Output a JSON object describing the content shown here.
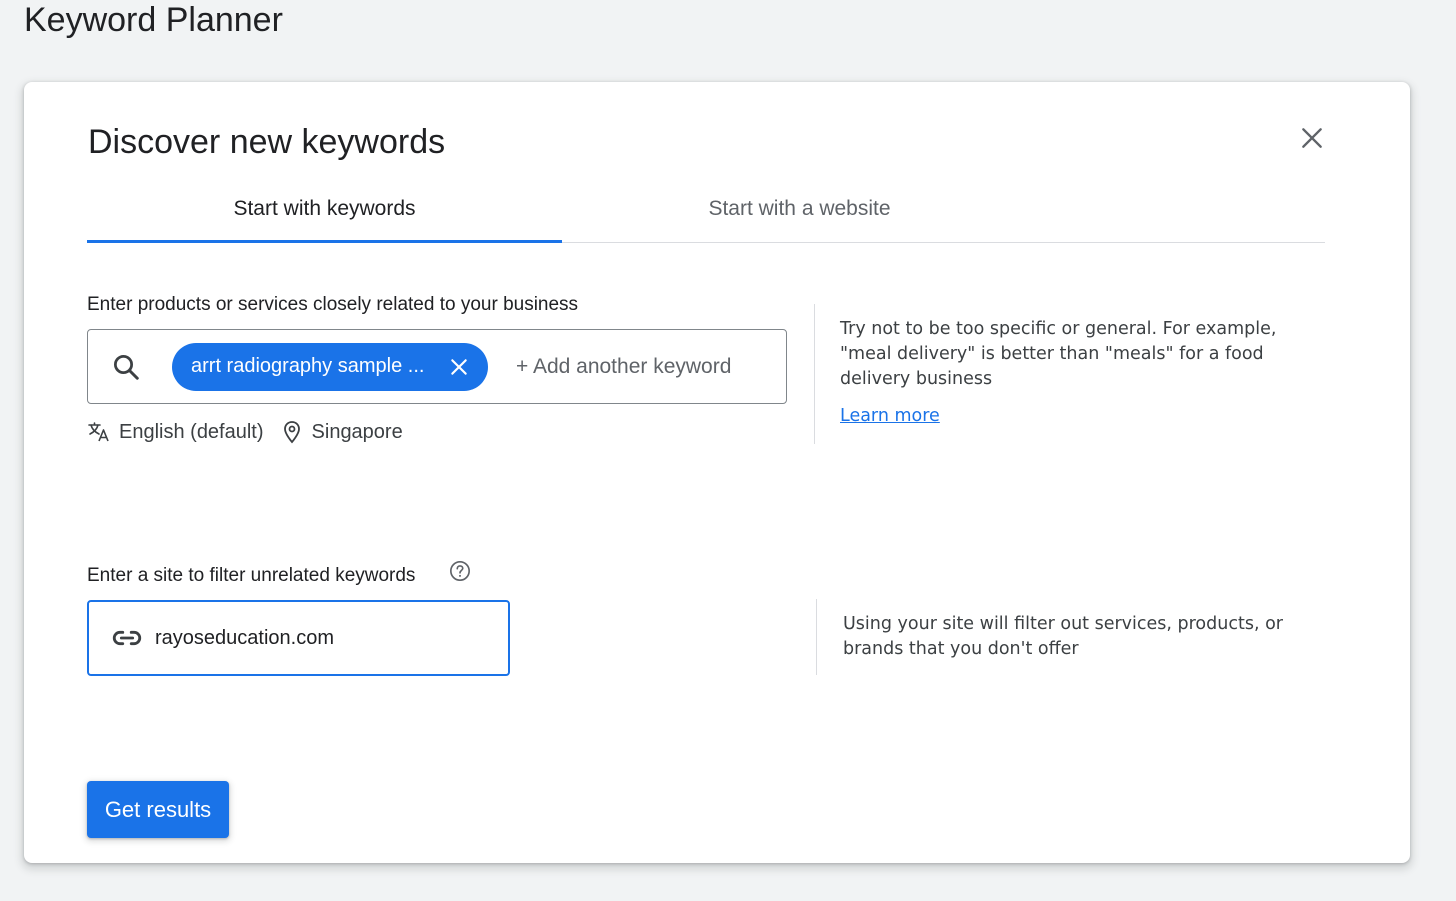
{
  "page": {
    "title": "Keyword Planner"
  },
  "dialog": {
    "title": "Discover new keywords",
    "tabs": [
      {
        "label": "Start with keywords",
        "active": true
      },
      {
        "label": "Start with a website",
        "active": false
      }
    ],
    "keywords_section": {
      "label": "Enter products or services closely related to your business",
      "chips": [
        {
          "label": "arrt radiography sample ..."
        }
      ],
      "add_placeholder": "+ Add another keyword",
      "language": "English (default)",
      "location": "Singapore",
      "help": "Try not to be too specific or general. For example, \"meal delivery\" is better than \"meals\" for a food delivery business",
      "learn_more": "Learn more"
    },
    "site_section": {
      "label": "Enter a site to filter unrelated keywords",
      "value": "rayoseducation.com",
      "help": "Using your site will filter out services, products, or brands that you don't offer"
    },
    "submit_label": "Get results"
  },
  "colors": {
    "accent": "#1a73e8",
    "text_primary": "#202124",
    "text_secondary": "#5f6368",
    "background": "#f1f3f4"
  },
  "icons": [
    "search-icon",
    "close-icon",
    "translate-icon",
    "location-pin-icon",
    "help-circle-icon",
    "link-icon"
  ]
}
